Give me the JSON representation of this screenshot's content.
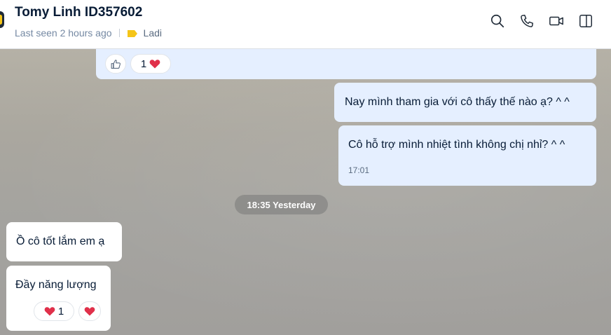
{
  "header": {
    "contact_name": "Tomy Linh ID357602",
    "last_seen": "Last seen 2 hours ago",
    "tag_label": "Ladi",
    "tag_color": "#f5c518",
    "icons": [
      "search-icon",
      "phone-icon",
      "video-call-icon",
      "sidebar-toggle-icon"
    ]
  },
  "messages": {
    "top_reactions": {
      "like_icon": "thumbs-up-icon",
      "count": "1",
      "reaction": "heart-icon"
    },
    "outgoing": [
      {
        "text": "Nay mình tham gia với cô thấy thế nào ạ? ^ ^"
      },
      {
        "text": "Cô hỗ trợ mình nhiệt tình không chị nhỉ? ^ ^",
        "time": "17:01"
      }
    ],
    "time_divider": "18:35 Yesterday",
    "incoming": [
      {
        "text": "Ồ cô tốt lắm em ạ"
      },
      {
        "text": "Đầy năng lượng",
        "reaction_count": "1",
        "reaction": "heart-icon"
      }
    ]
  },
  "colors": {
    "outgoing_bubble": "#e5efff",
    "incoming_bubble": "#ffffff",
    "text": "#081c36",
    "heart": "#e0304a"
  }
}
